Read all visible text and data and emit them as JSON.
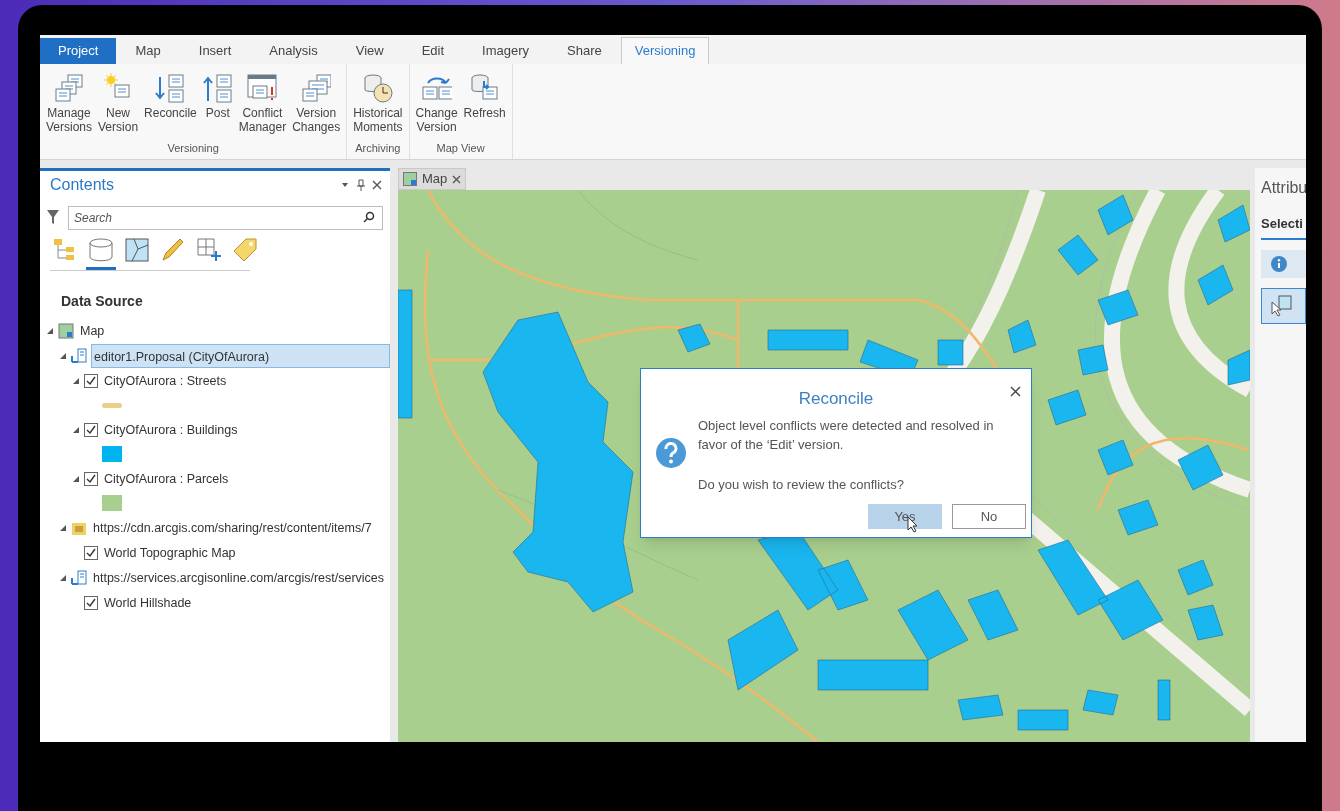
{
  "ribbon_tabs": [
    {
      "label": "Project",
      "kind": "backstage",
      "selected": false
    },
    {
      "label": "Map",
      "kind": "tab",
      "selected": false
    },
    {
      "label": "Insert",
      "kind": "tab",
      "selected": false
    },
    {
      "label": "Analysis",
      "kind": "tab",
      "selected": false
    },
    {
      "label": "View",
      "kind": "tab",
      "selected": false
    },
    {
      "label": "Edit",
      "kind": "tab",
      "selected": false
    },
    {
      "label": "Imagery",
      "kind": "tab",
      "selected": false
    },
    {
      "label": "Share",
      "kind": "tab",
      "selected": false
    },
    {
      "label": "Versioning",
      "kind": "tab",
      "selected": true
    }
  ],
  "ribbon_groups": [
    {
      "label": "Versioning",
      "buttons": [
        {
          "label": "Manage\nVersions",
          "kind": "manage"
        },
        {
          "label": "New\nVersion",
          "kind": "new"
        },
        {
          "label": "Reconcile",
          "kind": "reconcile"
        },
        {
          "label": "Post",
          "kind": "post"
        },
        {
          "label": "Conflict\nManager",
          "kind": "conflict"
        },
        {
          "label": "Version\nChanges",
          "kind": "changes"
        }
      ]
    },
    {
      "label": "Archiving",
      "buttons": [
        {
          "label": "Historical\nMoments",
          "kind": "historical"
        }
      ]
    },
    {
      "label": "Map View",
      "buttons": [
        {
          "label": "Change\nVersion",
          "kind": "change"
        },
        {
          "label": "Refresh",
          "kind": "refresh"
        }
      ]
    }
  ],
  "contents": {
    "title": "Contents",
    "search": {
      "placeholder": "Search"
    },
    "view_buttons": [
      {
        "kind": "drawing_order",
        "selected": false
      },
      {
        "kind": "data_source",
        "selected": true
      },
      {
        "kind": "selection",
        "selected": false
      },
      {
        "kind": "editing",
        "selected": false
      },
      {
        "kind": "snapping",
        "selected": false
      },
      {
        "kind": "labeling",
        "selected": false
      }
    ],
    "heading": "Data Source",
    "tree": [
      {
        "label": "Map",
        "kind": "map",
        "expanded": true,
        "selected": false,
        "children": [
          {
            "label": "editor1.Proposal (CityOfAurora)",
            "kind": "version",
            "expanded": true,
            "selected": true,
            "children": [
              {
                "label": "CityOfAurora : Streets",
                "expanded": true,
                "checked": true,
                "selected": false,
                "swatch": {
                  "kind": "line",
                  "color": "#e8cf8a"
                }
              },
              {
                "label": "CityOfAurora : Buildings",
                "expanded": true,
                "checked": true,
                "selected": false,
                "swatch": {
                  "kind": "fill",
                  "color": "#00b4f0"
                }
              },
              {
                "label": "CityOfAurora : Parcels",
                "expanded": true,
                "checked": true,
                "selected": false,
                "swatch": {
                  "kind": "fill",
                  "color": "#a8cf8f"
                }
              }
            ]
          },
          {
            "label": "https://cdn.arcgis.com/sharing/rest/content/items/7",
            "kind": "tiles",
            "expanded": true,
            "selected": false,
            "children": [
              {
                "label": "World Topographic Map",
                "checked": true,
                "selected": false
              }
            ]
          },
          {
            "label": "https://services.arcgisonline.com/arcgis/rest/services",
            "kind": "service",
            "expanded": true,
            "selected": false,
            "children": [
              {
                "label": "World Hillshade",
                "checked": true,
                "selected": false
              }
            ]
          }
        ]
      }
    ]
  },
  "map_tab": {
    "label": "Map"
  },
  "dialog": {
    "title": "Reconcile",
    "message": "Object level conflicts were detected and resolved in favor of the ‘Edit’ version.",
    "question": "Do you wish to review the conflicts?",
    "buttons": [
      {
        "label": "Yes",
        "selected": true
      },
      {
        "label": "No",
        "selected": false
      }
    ]
  },
  "attributes": {
    "title": "Attribu",
    "tab": "Selecti"
  }
}
